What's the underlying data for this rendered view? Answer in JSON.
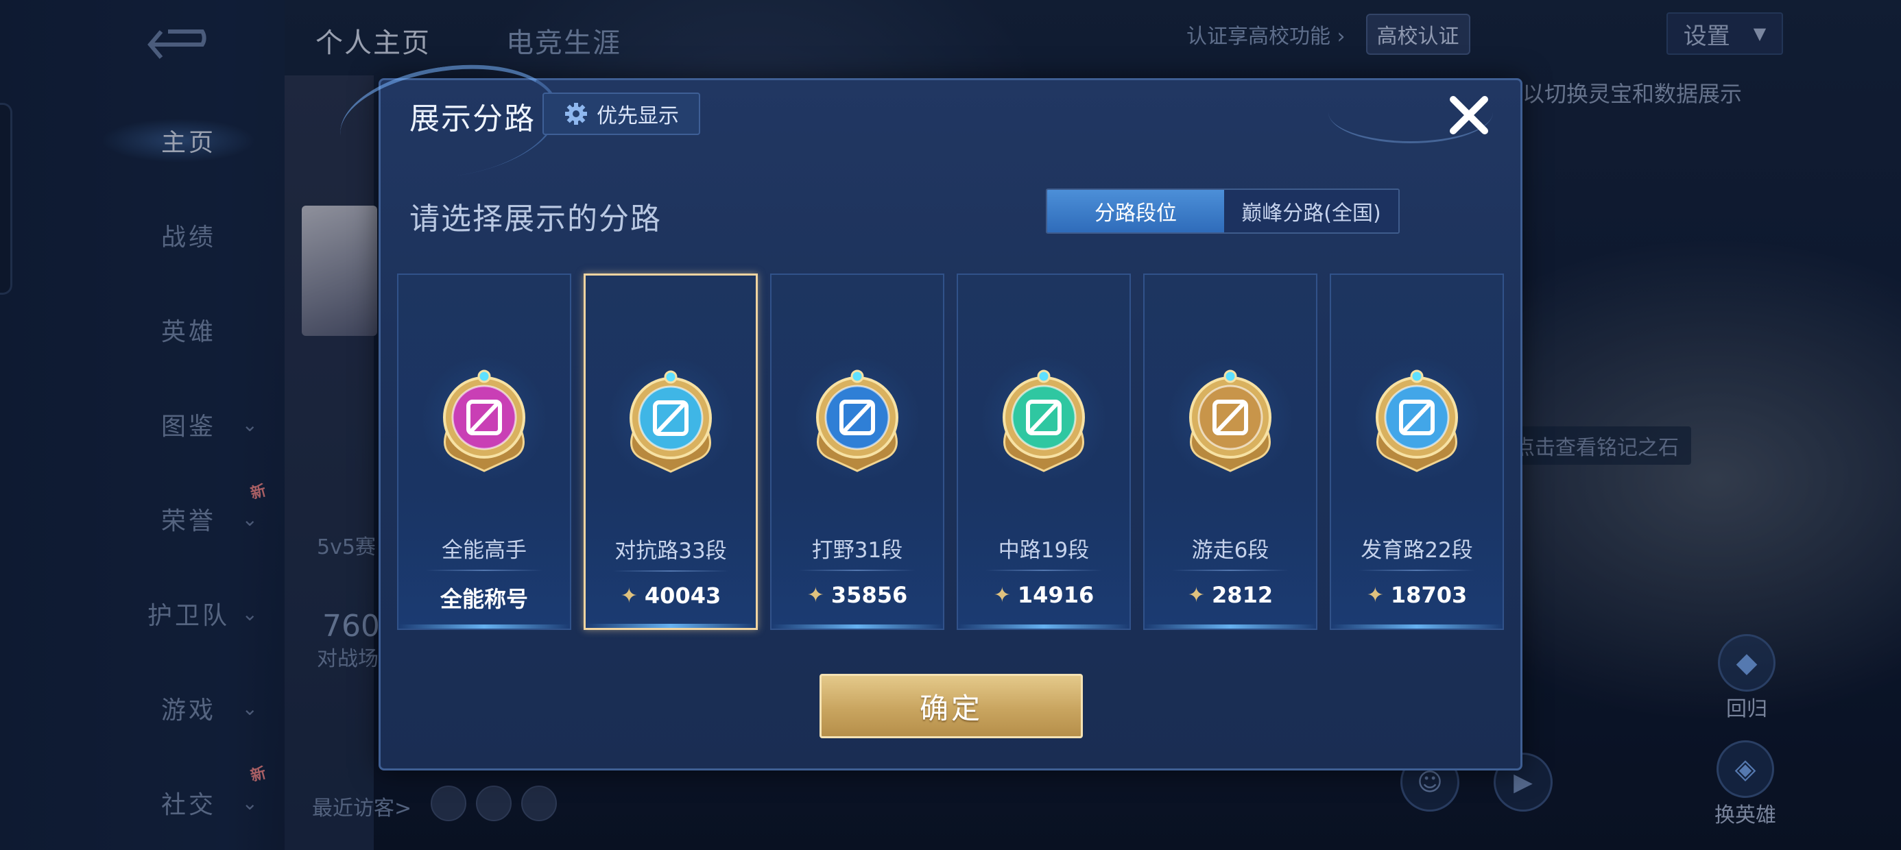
{
  "background": {
    "nav": [
      {
        "label": "主页",
        "active": true
      },
      {
        "label": "战绩"
      },
      {
        "label": "英雄"
      },
      {
        "label": "图鉴",
        "chevron": true
      },
      {
        "label": "荣誉",
        "chevron": true,
        "badge": "新"
      },
      {
        "label": "护卫队",
        "chevron": true
      },
      {
        "label": "游戏",
        "chevron": true
      },
      {
        "label": "社交",
        "chevron": true,
        "badge": "新"
      }
    ],
    "tabs": [
      "个人主页",
      "电竞生涯"
    ],
    "cert_link": "认证享高校功能",
    "cert_arrow": "›",
    "school_badge": "高校认证",
    "settings": "设置",
    "hint": "以切换灵宝和数据展示",
    "stone_hint": "点击查看铭记之石",
    "recent_visitors": "最近访客>",
    "match_label": "5v5赛",
    "stat_value": "760",
    "stat_label": "对战场",
    "return_label": "回归",
    "change_hero": "换英雄"
  },
  "dialog": {
    "title": "展示分路",
    "priority_label": "优先显示",
    "subtitle": "请选择展示的分路",
    "toggle": [
      {
        "label": "分路段位",
        "active": true
      },
      {
        "label": "巅峰分路(全国)",
        "active": false
      }
    ],
    "lanes": [
      {
        "name": "全能高手",
        "value": "全能称号",
        "has_points": false,
        "color": "#c93fb5",
        "icon": "allround-badge-icon",
        "selected": false
      },
      {
        "name": "对抗路33段",
        "value": "40043",
        "has_points": true,
        "color": "#3fb6e6",
        "icon": "clash-lane-badge-icon",
        "selected": true
      },
      {
        "name": "打野31段",
        "value": "35856",
        "has_points": true,
        "color": "#2f7fd6",
        "icon": "jungle-badge-icon",
        "selected": false
      },
      {
        "name": "中路19段",
        "value": "14916",
        "has_points": true,
        "color": "#2fc7a1",
        "icon": "mid-lane-badge-icon",
        "selected": false
      },
      {
        "name": "游走6段",
        "value": "2812",
        "has_points": true,
        "color": "#c8954a",
        "icon": "roam-badge-icon",
        "selected": false
      },
      {
        "name": "发育路22段",
        "value": "18703",
        "has_points": true,
        "color": "#42a6e8",
        "icon": "farm-lane-badge-icon",
        "selected": false
      }
    ],
    "confirm_label": "确定",
    "close_icon": "close-icon",
    "points_icon": "points-icon"
  }
}
